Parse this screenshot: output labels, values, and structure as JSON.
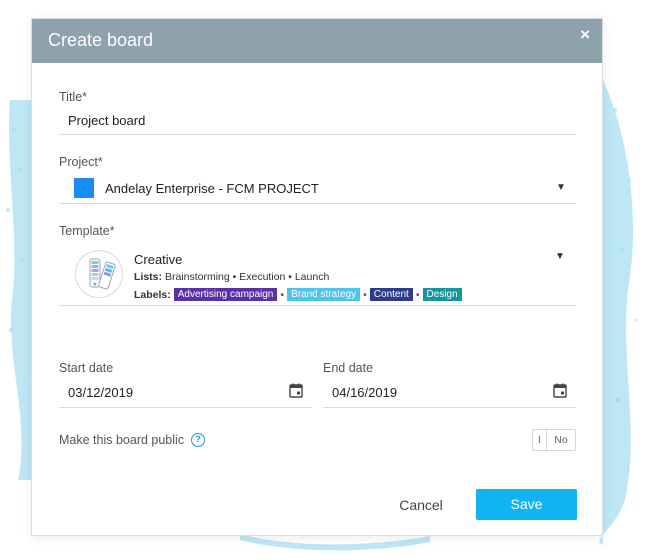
{
  "dialog": {
    "title": "Create board",
    "close_glyph": "×"
  },
  "form": {
    "title": {
      "label": "Title*",
      "value": "Project board"
    },
    "project": {
      "label": "Project*",
      "value": "Andelay Enterprise - FCM PROJECT",
      "color": "#1a8ef0",
      "caret": "▼"
    },
    "template": {
      "label": "Template*",
      "name": "Creative",
      "lists_prefix": "Lists:",
      "lists_text": "Brainstorming • Execution • Launch",
      "labels_prefix": "Labels:",
      "labels": [
        {
          "text": "Advertising campaign",
          "color": "#5a2fa8"
        },
        {
          "text": "Brand strategy",
          "color": "#4cc4ee"
        },
        {
          "text": "Content",
          "color": "#2d3c8a"
        },
        {
          "text": "Design",
          "color": "#14969e"
        }
      ],
      "separator": "•",
      "caret": "▼",
      "icon": "color-swatch-icon"
    },
    "start_date": {
      "label": "Start date",
      "value": "03/12/2019",
      "icon": "calendar-icon"
    },
    "end_date": {
      "label": "End date",
      "value": "04/16/2019",
      "icon": "calendar-icon"
    },
    "public": {
      "label": "Make this board public",
      "help_glyph": "?",
      "toggle_on": "I",
      "toggle_off": "No"
    }
  },
  "actions": {
    "cancel_label": "Cancel",
    "save_label": "Save",
    "save_color": "#10b4f3"
  },
  "colors": {
    "header": "#8da2ad",
    "accent": "#10b4f3",
    "splash": "#7fd0ea"
  }
}
